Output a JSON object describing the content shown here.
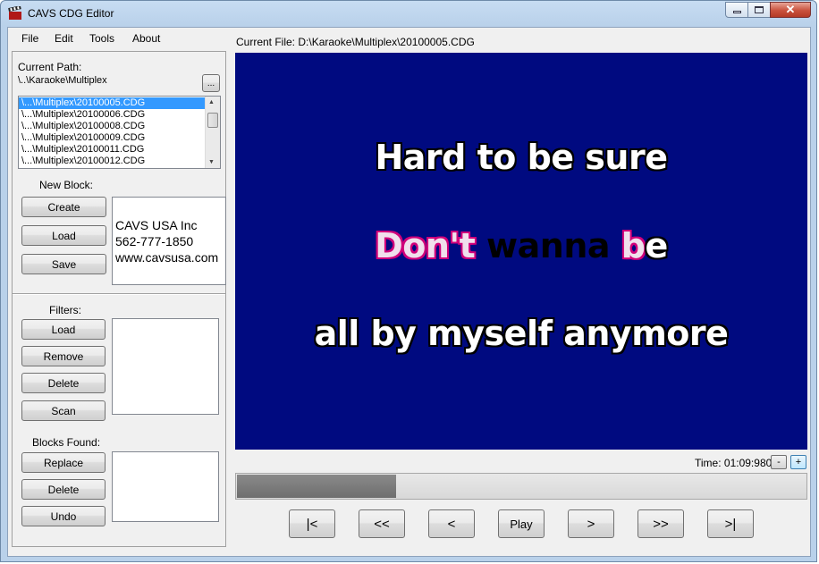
{
  "window": {
    "title": "CAVS CDG Editor",
    "controls": {
      "minimize": "▭",
      "maximize": "▢",
      "close": "✕"
    }
  },
  "menu": {
    "items": [
      "File",
      "Edit",
      "Tools",
      "About"
    ]
  },
  "left": {
    "current_path_label": "Current Path:",
    "current_path_value": "\\..\\Karaoke\\Multiplex",
    "browse_label": "...",
    "files": [
      "\\...\\Multiplex\\20100005.CDG",
      "\\...\\Multiplex\\20100006.CDG",
      "\\...\\Multiplex\\20100008.CDG",
      "\\...\\Multiplex\\20100009.CDG",
      "\\...\\Multiplex\\20100011.CDG",
      "\\...\\Multiplex\\20100012.CDG"
    ],
    "selected_index": 0,
    "new_block": {
      "label": "New Block:",
      "create": "Create",
      "load": "Load",
      "save": "Save",
      "info_lines": [
        "CAVS USA Inc",
        "562-777-1850",
        "www.cavsusa.com"
      ]
    },
    "filters": {
      "label": "Filters:",
      "load": "Load",
      "remove": "Remove",
      "delete": "Delete",
      "scan": "Scan"
    },
    "blocks_found": {
      "label": "Blocks Found:",
      "replace": "Replace",
      "delete": "Delete",
      "undo": "Undo"
    }
  },
  "main": {
    "current_file_label": "Current File:",
    "current_file_value": "D:\\Karaoke\\Multiplex\\20100005.CDG",
    "lyrics": {
      "line1": "Hard to be sure",
      "line2_sung": "Don't",
      "line2_unsung_dark": "wanna",
      "line2_sung_end": "b",
      "line2_rest": "e",
      "line3": "all by myself anymore"
    },
    "time_label": "Time:",
    "time_value": "01:09:980",
    "minus_label": "-",
    "plus_label": "+",
    "progress": 0.28,
    "transport": {
      "first": "|<",
      "rewind": "<<",
      "prev": "<",
      "play": "Play",
      "next": ">",
      "forward": ">>",
      "last": ">|"
    }
  },
  "colors": {
    "display_bg": "#000a80",
    "highlight": "#d0007a",
    "selection": "#3399ff"
  }
}
